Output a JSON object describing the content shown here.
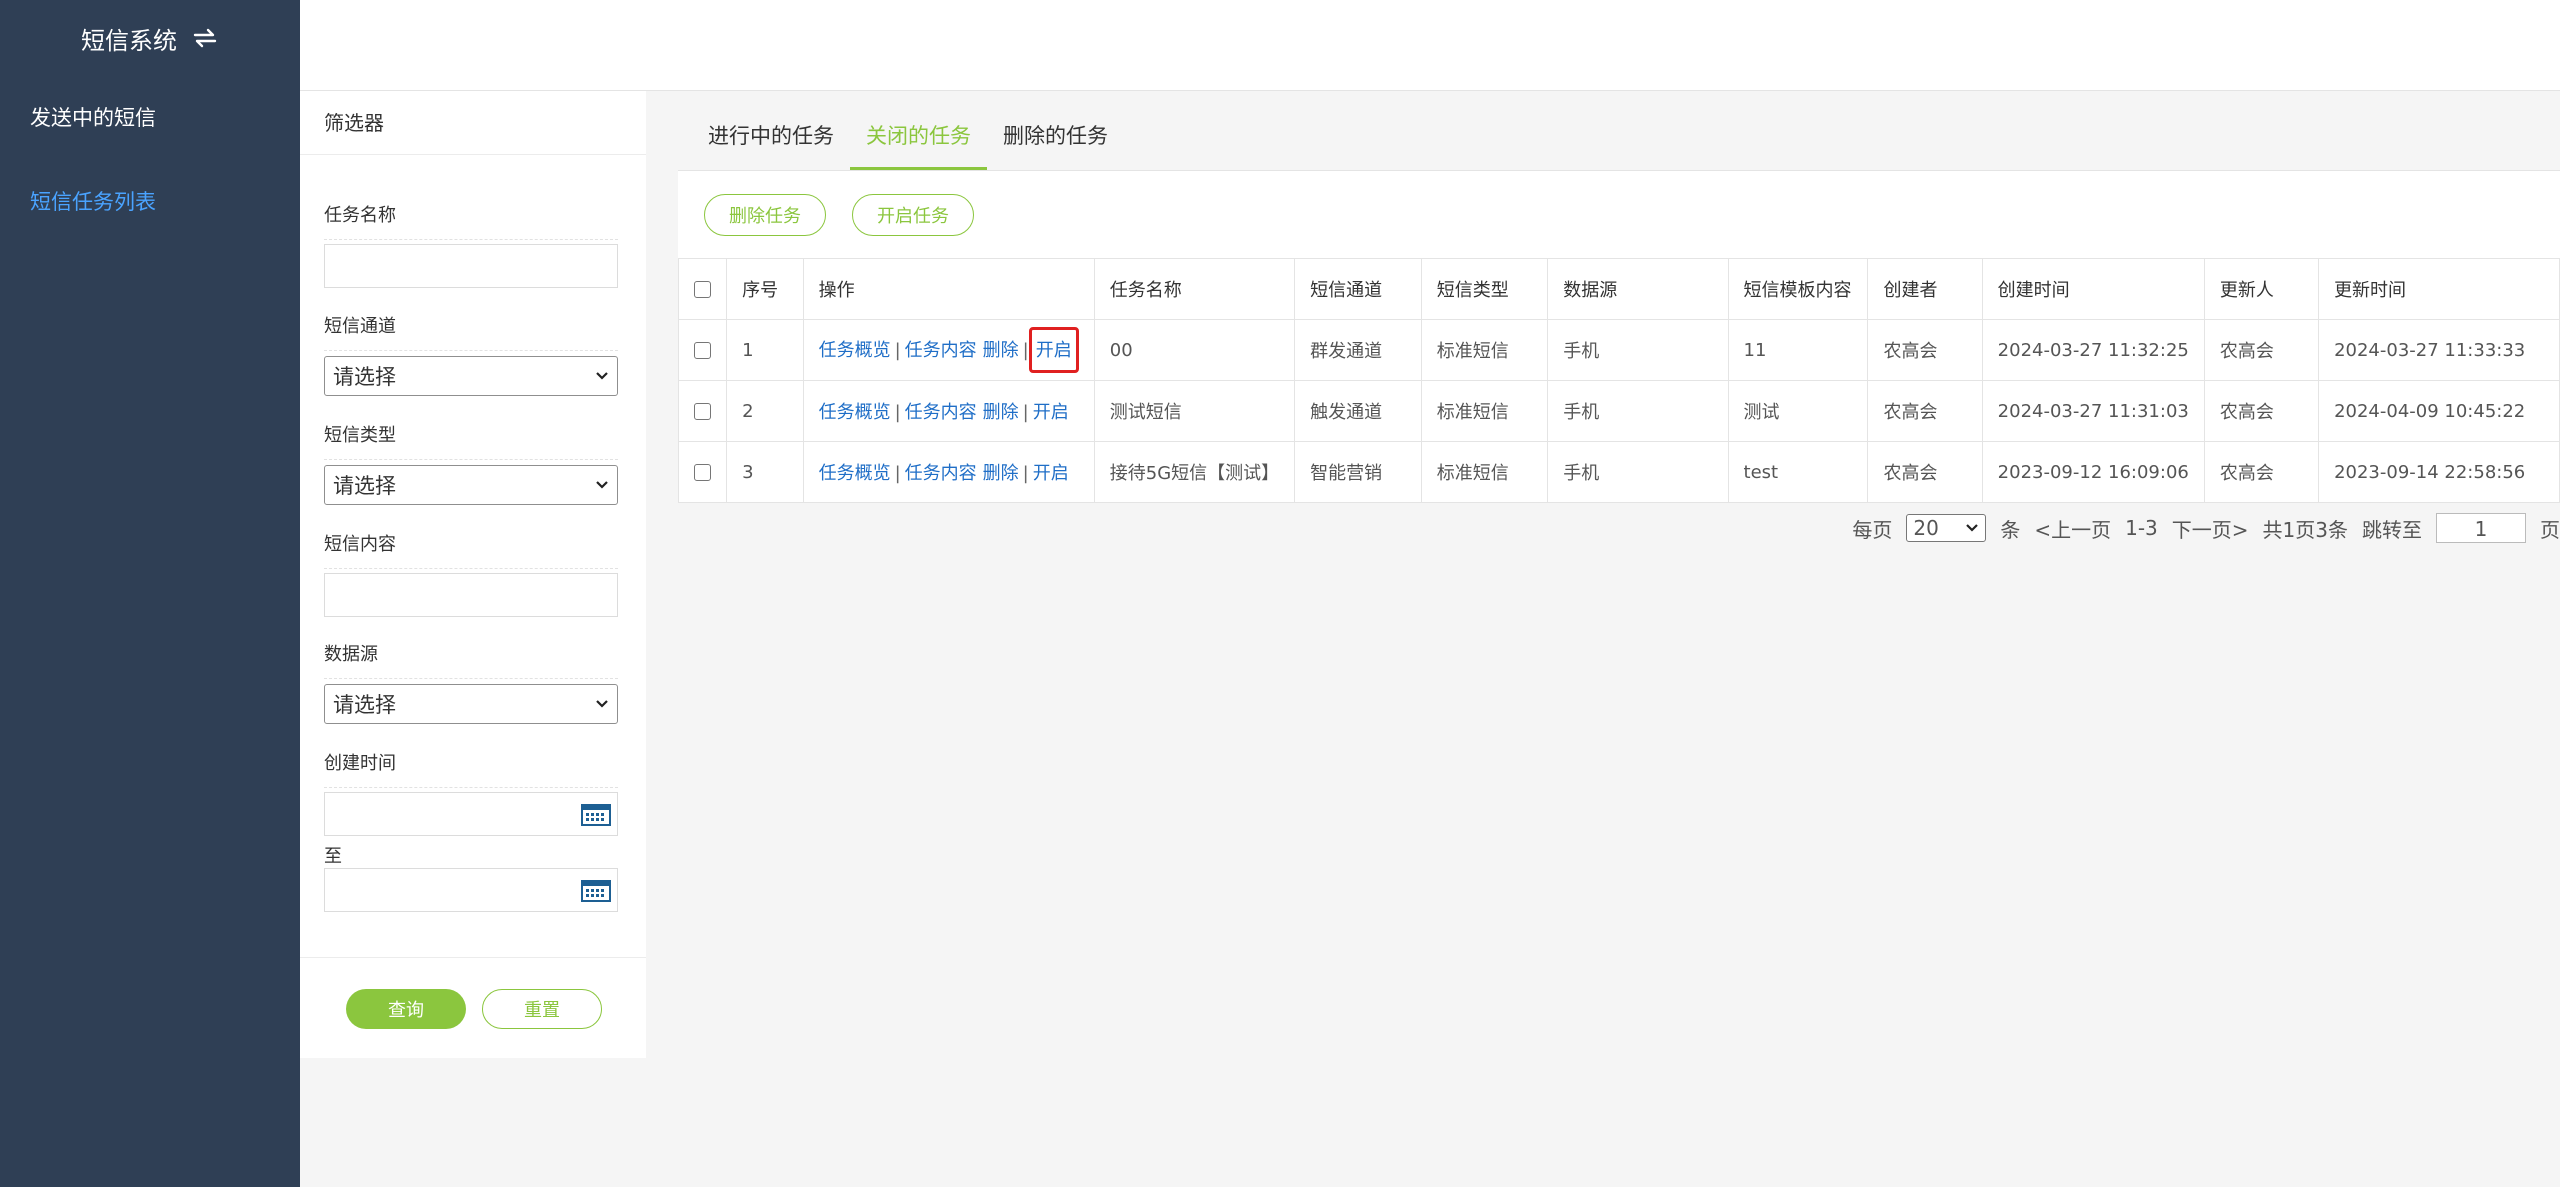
{
  "app": {
    "title": "短信系统",
    "nav": [
      {
        "label": "发送中的短信"
      },
      {
        "label": "短信任务列表"
      }
    ]
  },
  "filter": {
    "title": "筛选器",
    "task_name_label": "任务名称",
    "task_name_value": "",
    "channel_label": "短信通道",
    "channel_value": "请选择",
    "type_label": "短信类型",
    "type_value": "请选择",
    "content_label": "短信内容",
    "content_value": "",
    "source_label": "数据源",
    "source_value": "请选择",
    "created_label": "创建时间",
    "created_from": "",
    "to_label": "至",
    "created_to": "",
    "query_label": "查询",
    "reset_label": "重置"
  },
  "tabs": [
    {
      "label": "进行中的任务"
    },
    {
      "label": "关闭的任务",
      "active": true
    },
    {
      "label": "删除的任务"
    }
  ],
  "actions": {
    "delete_label": "删除任务",
    "enable_label": "开启任务"
  },
  "table": {
    "headers": [
      "序号",
      "操作",
      "任务名称",
      "短信通道",
      "短信类型",
      "数据源",
      "短信模板内容",
      "创建者",
      "创建时间",
      "更新人",
      "更新时间"
    ],
    "op_labels": {
      "overview": "任务概览",
      "content": "任务内容",
      "delete": "删除",
      "enable": "开启",
      "sep": "|"
    },
    "rows": [
      {
        "no": "1",
        "name": "00",
        "channel": "群发通道",
        "type": "标准短信",
        "source": "手机",
        "template": "11",
        "creator": "农高会",
        "created": "2024-03-27 11:32:25",
        "updater": "农高会",
        "updated": "2024-03-27 11:33:33"
      },
      {
        "no": "2",
        "name": "测试短信",
        "channel": "触发通道",
        "type": "标准短信",
        "source": "手机",
        "template": "测试",
        "creator": "农高会",
        "created": "2024-03-27 11:31:03",
        "updater": "农高会",
        "updated": "2024-04-09 10:45:22"
      },
      {
        "no": "3",
        "name": "接待5G短信【测试】",
        "channel": "智能营销",
        "type": "标准短信",
        "source": "手机",
        "template": "test",
        "creator": "农高会",
        "created": "2023-09-12 16:09:06",
        "updater": "农高会",
        "updated": "2023-09-14 22:58:56"
      }
    ]
  },
  "pager": {
    "per_page_label": "每页",
    "per_page_value": "20",
    "unit_label": "条",
    "prev_label": "<上一页",
    "range": "1-3",
    "next_label": "下一页>",
    "summary": "共1页3条",
    "jump_label": "跳转至",
    "jump_value": "1",
    "page_label": "页"
  },
  "colors": {
    "sidebar_bg": "#2f3f55",
    "accent_green": "#8bc63e",
    "link_blue": "#1f6ec7",
    "active_nav": "#4aa3ff",
    "highlight_red": "#e02020"
  }
}
